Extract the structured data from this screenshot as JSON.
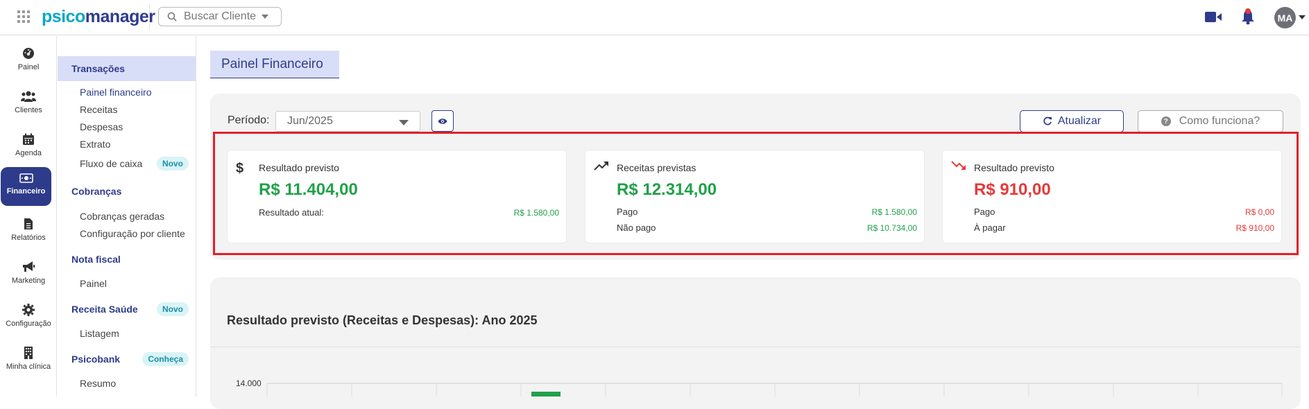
{
  "topbar": {
    "logo_part1": "psico",
    "logo_part2": "manager",
    "search_placeholder": "Buscar Cliente",
    "avatar_initials": "MA"
  },
  "rail": {
    "items": [
      {
        "label": "Painel",
        "icon": "dashboard-icon"
      },
      {
        "label": "Clientes",
        "icon": "users-icon"
      },
      {
        "label": "Agenda",
        "icon": "calendar-icon"
      },
      {
        "label": "Financeiro",
        "icon": "money-icon"
      },
      {
        "label": "Relatórios",
        "icon": "file-icon"
      },
      {
        "label": "Marketing",
        "icon": "megaphone-icon"
      },
      {
        "label": "Configuração",
        "icon": "gear-icon"
      },
      {
        "label": "Minha clínica",
        "icon": "building-icon"
      }
    ]
  },
  "submenu": {
    "transacoes": "Transações",
    "painel_financeiro": "Painel financeiro",
    "receitas": "Receitas",
    "despesas": "Despesas",
    "extrato": "Extrato",
    "fluxo_de_caixa": "Fluxo de caixa",
    "novo_badge": "Novo",
    "cobrancas": "Cobranças",
    "cobrancas_geradas": "Cobranças geradas",
    "config_por_cliente": "Configuração por cliente",
    "nota_fiscal": "Nota fiscal",
    "nf_painel": "Painel",
    "receita_saude": "Receita Saúde",
    "novo_badge_2": "Novo",
    "listagem": "Listagem",
    "psicobank": "Psicobank",
    "conheca_badge": "Conheça",
    "resumo": "Resumo"
  },
  "main": {
    "page_title": "Painel Financeiro",
    "periodo_label": "Período:",
    "periodo_value": "Jun/2025",
    "atualizar_label": "Atualizar",
    "como_funciona_label": "Como funciona?"
  },
  "cards": [
    {
      "title": "Resultado previsto",
      "value": "R$ 11.404,00",
      "rows": [
        {
          "label": "Resultado atual:",
          "value": "R$ 1.580,00"
        }
      ]
    },
    {
      "title": "Receitas previstas",
      "value": "R$ 12.314,00",
      "rows": [
        {
          "label": "Pago",
          "value": "R$ 1.580,00"
        },
        {
          "label": "Não pago",
          "value": "R$ 10.734,00"
        }
      ]
    },
    {
      "title": "Resultado previsto",
      "value": "R$ 910,00",
      "rows": [
        {
          "label": "Pago",
          "value": "R$ 0,00"
        },
        {
          "label": "À pagar",
          "value": "R$ 910,00"
        }
      ]
    }
  ],
  "chart": {
    "title": "Resultado previsto (Receitas e Despesas): Ano 2025",
    "ytick_top": "14.000"
  },
  "colors": {
    "brand": "#2e3b8a",
    "positive": "#21a04a",
    "negative": "#e53a3a",
    "highlight": "#e3202a"
  }
}
